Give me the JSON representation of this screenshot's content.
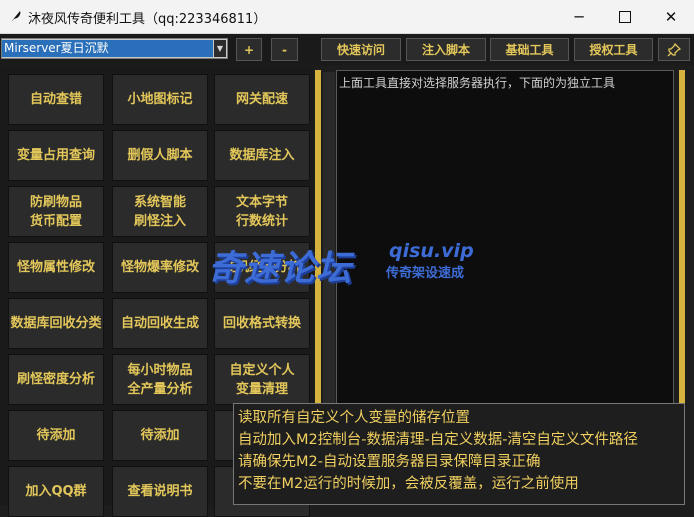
{
  "window": {
    "title": "沐夜风传奇便利工具（qq:223346811）",
    "icon": "feather-icon",
    "controls": {
      "minimize": "─",
      "close": "✕"
    }
  },
  "toolbar": {
    "server_selected": "Mirserver夏日沉默",
    "plus": "+",
    "minus": "-",
    "tabs": [
      "快速访问",
      "注入脚本",
      "基础工具",
      "授权工具"
    ],
    "pin_icon": "pin-icon"
  },
  "tools": [
    [
      "自动查错",
      "小地图标记",
      "网关配速"
    ],
    [
      "变量占用查询",
      "删假人脚本",
      "数据库注入"
    ],
    [
      "防刷物品\n货币配置",
      "系统智能\n刷怪注入",
      "文本字节\n行数统计"
    ],
    [
      "怪物属性修改",
      "怪物爆率修改",
      "挂机经验分析"
    ],
    [
      "数据库回收分类",
      "自动回收生成",
      "回收格式转换"
    ],
    [
      "刷怪密度分析",
      "每小时物品\n全产量分析",
      "自定义个人\n变量清理"
    ],
    [
      "待添加",
      "待添加",
      ""
    ],
    [
      "加入QQ群",
      "查看说明书",
      ""
    ]
  ],
  "output": {
    "text": "上面工具直接对选择服务器执行，下面的为独立工具"
  },
  "tooltip": {
    "lines": [
      "读取所有自定义个人变量的储存位置",
      "自动加入M2控制台-数据清理-自定义数据-清空自定义文件路径",
      "请确保先M2-自动设置服务器目录保障目录正确",
      "不要在M2运行的时候加，会被反覆盖，运行之前使用"
    ]
  },
  "watermark": {
    "main": "奇速论坛",
    "url": "qisu.vip",
    "sub": "传奇架设速成"
  },
  "colors": {
    "accent_gold": "#e3c75a",
    "divider_gold": "#d5b33e",
    "selection_blue": "#2a6fb9",
    "watermark_blue": "#3d6cd6"
  }
}
